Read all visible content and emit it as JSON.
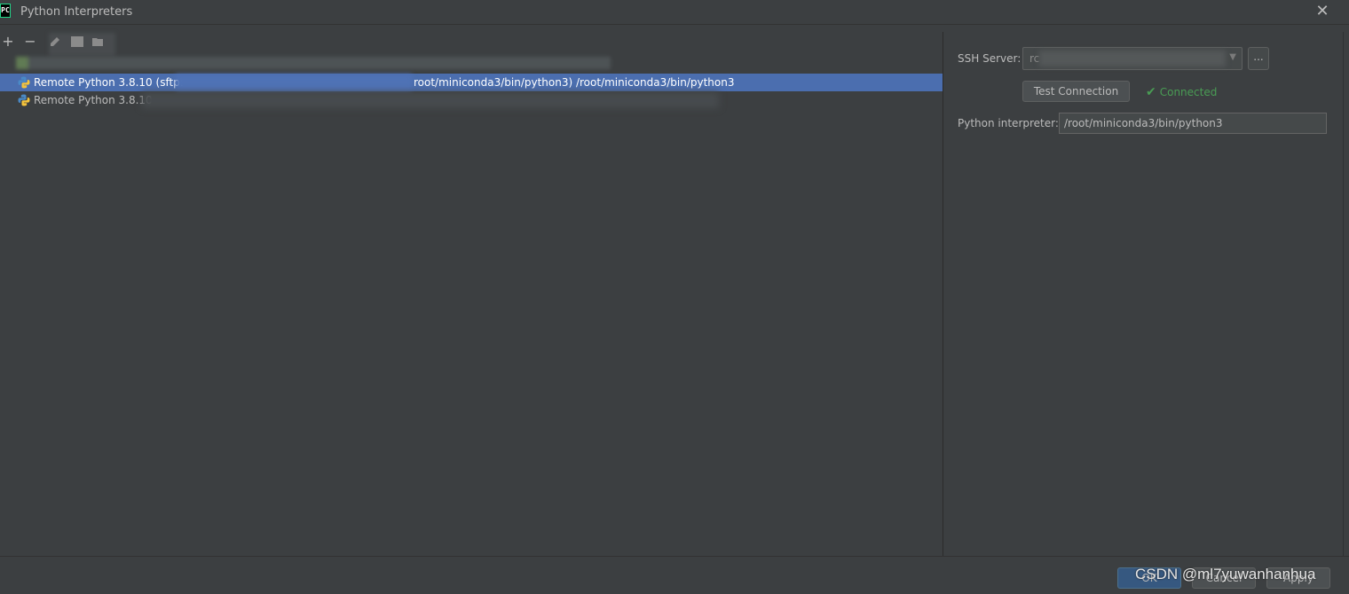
{
  "window": {
    "title": "Python Interpreters",
    "logo_text": "PC",
    "close_glyph": "✕"
  },
  "toolbar": {
    "add_glyph": "+",
    "remove_glyph": "−"
  },
  "interpreters": [
    {
      "label": "",
      "selected": false
    },
    {
      "label": "Remote Python 3.8.10 (sftp:",
      "path": "root/miniconda3/bin/python3) /root/miniconda3/bin/python3",
      "selected": true
    },
    {
      "label": "Remote Python 3.8.10",
      "selected": false
    }
  ],
  "ssh": {
    "label": "SSH Server:",
    "value": "rc",
    "dropdown_glyph": "▼",
    "browse_label": "..."
  },
  "connection": {
    "test_button": "Test Connection",
    "status": "Connected",
    "status_color": "#499c54"
  },
  "interpreter_field": {
    "label": "Python interpreter:",
    "value": "/root/miniconda3/bin/python3"
  },
  "footer": {
    "ok": "OK",
    "cancel": "Cancel",
    "apply": "Apply"
  },
  "watermark": "CSDN @ml7yuwanhanhua",
  "colors": {
    "background": "#3c3f41",
    "selection": "#4b6eaf",
    "status_ok": "#499c54"
  }
}
